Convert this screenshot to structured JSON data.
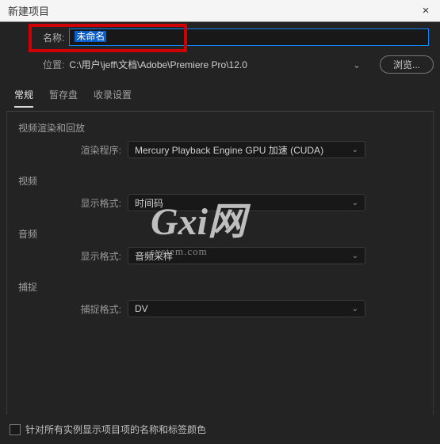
{
  "titlebar": {
    "title": "新建项目",
    "close_icon": "×"
  },
  "name_row": {
    "label": "名称:",
    "value": "未命名"
  },
  "location_row": {
    "label": "位置:",
    "path": "C:\\用户\\jeff\\文档\\Adobe\\Premiere Pro\\12.0",
    "browse_label": "浏览..."
  },
  "tabs": [
    {
      "label": "常规",
      "active": true
    },
    {
      "label": "暂存盘",
      "active": false
    },
    {
      "label": "收录设置",
      "active": false
    }
  ],
  "sections": {
    "render": {
      "title": "视频渲染和回放",
      "field_label": "渲染程序:",
      "value": "Mercury Playback Engine GPU 加速 (CUDA)"
    },
    "video": {
      "title": "视频",
      "field_label": "显示格式:",
      "value": "时间码"
    },
    "audio": {
      "title": "音频",
      "field_label": "显示格式:",
      "value": "音频采样"
    },
    "capture": {
      "title": "捕捉",
      "field_label": "捕捉格式:",
      "value": "DV"
    }
  },
  "checkbox": {
    "label": "针对所有实例显示项目项的名称和标签颜色"
  },
  "watermark": {
    "line1": "Gxi网",
    "line2": "system.com"
  },
  "chevron": "⌄"
}
